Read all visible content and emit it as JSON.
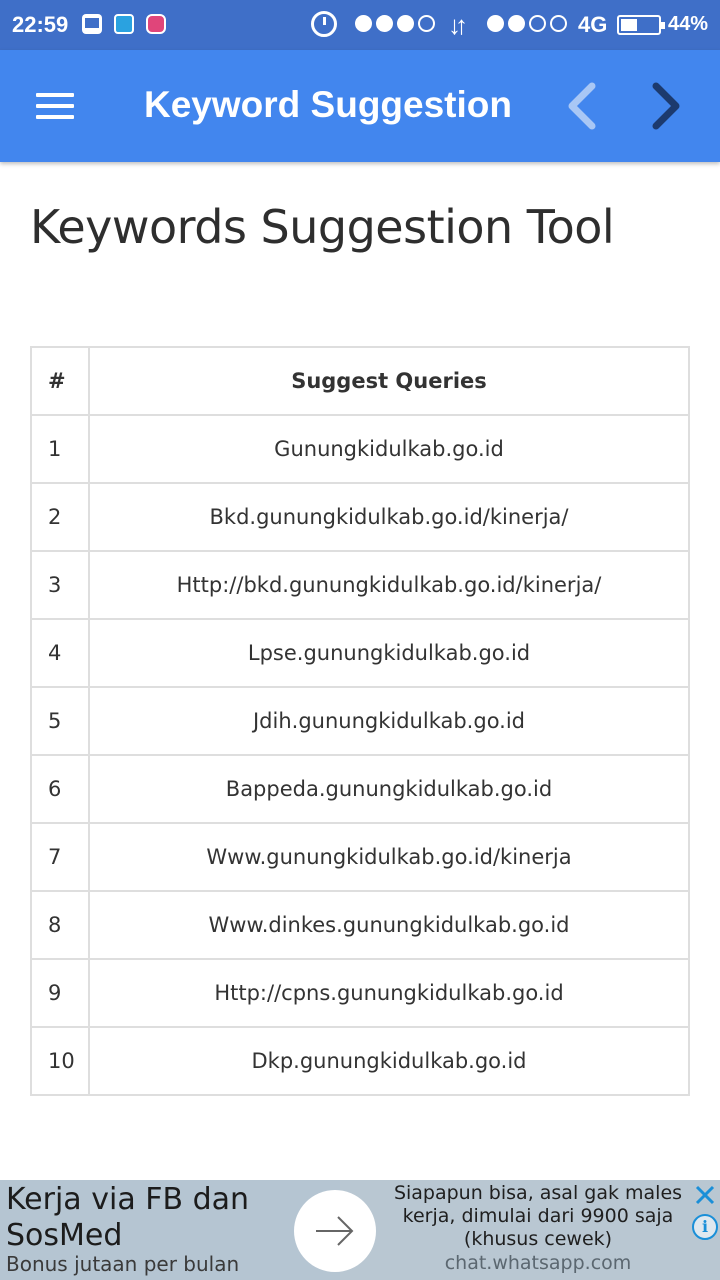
{
  "status_bar": {
    "time": "22:59",
    "network": "4G",
    "battery": "44%",
    "battery_level": 0.44,
    "icons": [
      "bbm-icon",
      "mi-icon",
      "instagram-icon",
      "alarm-icon",
      "signal-dots-icon",
      "data-arrows-icon",
      "battery-icon"
    ]
  },
  "app_bar": {
    "title": "Keyword Suggestion",
    "menu_icon": "hamburger-menu-icon",
    "back_icon": "chevron-left-icon",
    "forward_icon": "chevron-right-icon",
    "color": "#4286ee"
  },
  "main": {
    "heading": "Keywords Suggestion Tool",
    "table": {
      "columns": [
        "#",
        "Suggest Queries"
      ],
      "rows": [
        {
          "num": "1",
          "query": "Gunungkidulkab.go.id"
        },
        {
          "num": "2",
          "query": "Bkd.gunungkidulkab.go.id/kinerja/"
        },
        {
          "num": "3",
          "query": "Http://bkd.gunungkidulkab.go.id/kinerja/"
        },
        {
          "num": "4",
          "query": "Lpse.gunungkidulkab.go.id"
        },
        {
          "num": "5",
          "query": "Jdih.gunungkidulkab.go.id"
        },
        {
          "num": "6",
          "query": "Bappeda.gunungkidulkab.go.id"
        },
        {
          "num": "7",
          "query": "Www.gunungkidulkab.go.id/kinerja"
        },
        {
          "num": "8",
          "query": "Www.dinkes.gunungkidulkab.go.id"
        },
        {
          "num": "9",
          "query": "Http://cpns.gunungkidulkab.go.id"
        },
        {
          "num": "10",
          "query": "Dkp.gunungkidulkab.go.id"
        }
      ]
    }
  },
  "ad": {
    "title": "Kerja via FB dan SosMed",
    "subtitle": "Bonus jutaan per bulan",
    "description": "Siapapun bisa, asal gak males kerja, dimulai dari 9900 saja (khusus cewek)",
    "url": "chat.whatsapp.com",
    "info_label": "i",
    "close_color": "#1a8fd8"
  }
}
